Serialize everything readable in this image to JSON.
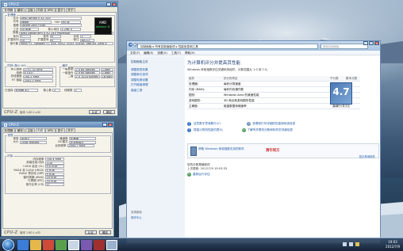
{
  "cpu_window": {
    "title": "CPU-Z",
    "tabs": [
      "处理器",
      "缓存",
      "主板",
      "内存",
      "SPD",
      "显卡",
      "关于"
    ],
    "processor_group_title": "处理器",
    "name_label": "名字",
    "name_value": "AMD Athlon II X2 245",
    "codename_label": "代号",
    "codename_value": "Regor",
    "tdp_label": "TDP",
    "tdp_value": "65 W",
    "package_label": "插槽",
    "package_value": "Socket AM3 (938)",
    "tech_label": "工艺",
    "tech_value": "45 纳米",
    "voltage_label": "核心电压",
    "voltage_value": "1.296 V",
    "spec_label": "规格",
    "spec_value": "AMD Athlon(tm) II X2 245 Processor",
    "family_label": "系列",
    "family_value": "F",
    "model_label": "型号",
    "model_value": "6",
    "stepping_label": "步进",
    "stepping_value": "2",
    "extfamily_label": "扩展系列",
    "extfamily_value": "10",
    "extmodel_label": "扩展型号",
    "extmodel_value": "6",
    "revision_label": "修订",
    "revision_value": "DA-C2",
    "instructions_label": "指令集",
    "instructions_value": "MMX(+), 3DNow!(+), SSE, SSE2, SSE3, SSE4A, x86-64, AMD-V",
    "clocks_group_title": "时钟 (核心 #0)",
    "core_speed_label": "核心速度",
    "core_speed_value": "1737.32 MHz",
    "multiplier_label": "倍频",
    "multiplier_value": "x 14.0",
    "bus_label": "总线速度",
    "bus_value": "200.2 MHz",
    "htlink_label": "HT 链接",
    "htlink_value": "2002.0 MHz",
    "cache_group_title": "缓存",
    "l1d_label": "一级数据",
    "l1d_value": "2 x 64 KBytes",
    "l1d_way": "2-way",
    "l1i_label": "一级指令",
    "l1i_value": "2 x 64 KBytes",
    "l1i_way": "2-way",
    "l2_label": "二级",
    "l2_value": "2 x 1024 KBytes",
    "l2_way": "16-way",
    "selection_label": "已选择",
    "selection_value": "处理器 #1",
    "cores_label": "核心数",
    "cores_value": "2",
    "threads_label": "线程数",
    "threads_value": "2",
    "logo_brand": "AMD",
    "logo_sub": "Athlon II",
    "footer_logo": "CPU-Z",
    "version": "版本 1.60.1.x32",
    "validate_button": "认证",
    "ok_button": "确定"
  },
  "mem_window": {
    "title": "CPU-Z",
    "tabs": [
      "处理器",
      "缓存",
      "主板",
      "内存",
      "SPD",
      "显卡",
      "关于"
    ],
    "general_group_title": "常规",
    "type_label": "类型",
    "type_value": "DDR3",
    "channels_label": "通道数",
    "channels_value": "双通道",
    "size_label": "大小",
    "size_value": "2048 MBytes",
    "dc_mode_label": "DC模式",
    "dc_mode_value": "非对称模式",
    "nb_freq_label": "北桥频率",
    "nb_freq_value": "2000.7 MHz",
    "timings_group_title": "时序",
    "dram_freq_label": "内存频率",
    "dram_freq_value": "700.4 MHz",
    "fsb_dram_label": "前端总线:内存",
    "fsb_dram_value": "3:10",
    "cas_label": "CAS# 延迟 (CL)",
    "cas_value": "9.0 时钟",
    "rcd_label": "RAS# 到 CAS# (tRCD)",
    "rcd_value": "9 时钟",
    "rp_label": "RAS# 预充电 (tRP)",
    "rp_value": "9 时钟",
    "ras_label": "循环周期 (tRAS)",
    "ras_value": "24 时钟",
    "rc_label": "行周期 (tRC)",
    "rc_value": "33 时钟",
    "cr_label": "指令比率 (CR)",
    "cr_value": "1T",
    "footer_logo": "CPU-Z",
    "version": "版本 1.60.1.x32",
    "validate_button": "认证",
    "ok_button": "确定"
  },
  "perf_window": {
    "address": "控制面板 ▸ 所有控制面板项 ▸ 性能信息和工具",
    "search_placeholder": "搜索控制面板",
    "menu": [
      "文件(F)",
      "编辑(E)",
      "查看(V)",
      "工具(T)",
      "帮助(H)"
    ],
    "side_home": "控制面板主页",
    "side_items": [
      "调整视觉效果",
      "调整索引选项",
      "调整电源设置",
      "打开磁盘清理",
      "高级工具"
    ],
    "see_also_title": "另请参阅",
    "see_also_items": [
      "操作中心"
    ],
    "heading": "为计算机评分并提高其性能",
    "subheading": "Windows 体验指数评估关键系统组件，分数范围从 1.0 到 7.9。",
    "table_headers": [
      "组件",
      "评分的项目",
      "子分数",
      "基本分数"
    ],
    "rows": [
      {
        "component": "处理器:",
        "item": "每秒计算速度",
        "score": "6.2"
      },
      {
        "component": "内存 (RAM):",
        "item": "每秒内存操作数",
        "score": "5.5"
      },
      {
        "component": "图形:",
        "item": "Windows Aero 的桌面性能",
        "score": "4.7"
      },
      {
        "component": "游戏图形:",
        "item": "3D 商业和游戏图形性能",
        "score": "5.5"
      },
      {
        "component": "主硬盘:",
        "item": "磁盘数据传输速率",
        "score": "5.4"
      }
    ],
    "base_score": "4.7",
    "base_caption": "由最低分数决定",
    "links": [
      "这些数字意味着什么?",
      "提高计算机性能的提示。"
    ],
    "right_links": [
      "查看和打印详细的性能和系统信息",
      "了解有关联机分数和软件的详细信息"
    ],
    "promo_text": "获取 Windows 体验指数支持的软件",
    "promo_logo": "清华同方",
    "promo_more": "显示其他软件",
    "footer_note": "您的分数是最新的",
    "last_update": "上次更新: 2012/7/9 19:03:33",
    "rerun": "重新运行评估"
  },
  "taskbar": {
    "time": "19:03",
    "date": "2012/7/9"
  },
  "colors": {
    "accent": "#1e5aa8",
    "title_blue": "#1e3f73",
    "base_score_bg": "#4a7ab5"
  }
}
